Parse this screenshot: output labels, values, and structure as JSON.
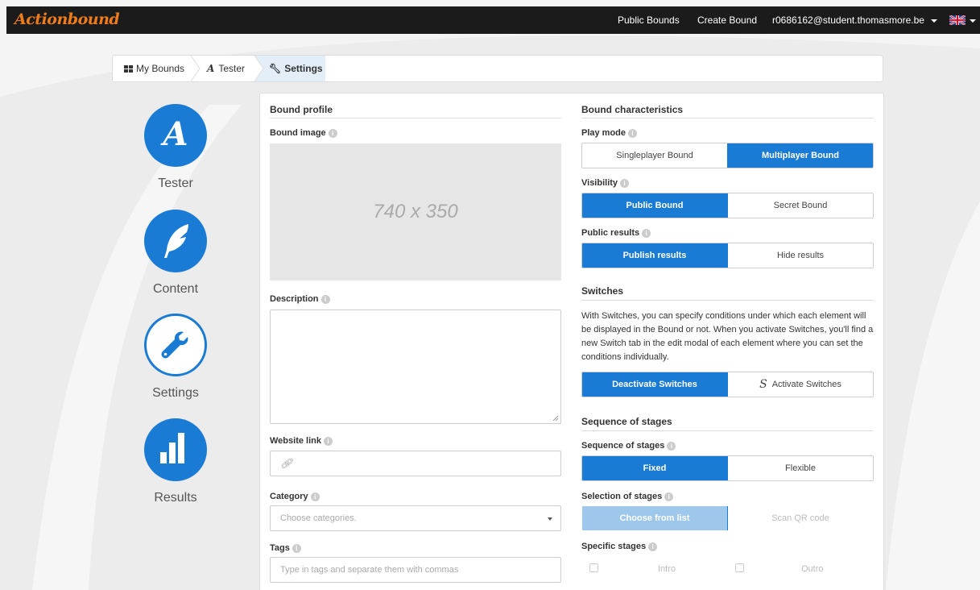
{
  "app": {
    "logo": "Actionbound",
    "nav": {
      "public_bounds": "Public Bounds",
      "create_bound": "Create Bound",
      "user": "r0686162@student.thomasmore.be"
    },
    "language_icon": "uk-flag-icon"
  },
  "breadcrumb": {
    "items": [
      "My Bounds",
      "Tester",
      "Settings"
    ]
  },
  "sidebar": {
    "items": [
      {
        "label": "Tester",
        "icon": "actionbound-a-icon"
      },
      {
        "label": "Content",
        "icon": "feather-icon"
      },
      {
        "label": "Settings",
        "icon": "wrench-icon"
      },
      {
        "label": "Results",
        "icon": "bar-chart-icon"
      }
    ]
  },
  "profile": {
    "title": "Bound profile",
    "image_label": "Bound image",
    "image_placeholder": "740 x 350",
    "description_label": "Description",
    "website_label": "Website link",
    "category_label": "Category",
    "category_placeholder": "Choose categories.",
    "tags_label": "Tags",
    "tags_placeholder": "Type in tags and separate them with commas"
  },
  "characteristics": {
    "title": "Bound characteristics",
    "play_mode_label": "Play mode",
    "play_mode_options": [
      "Singleplayer Bound",
      "Multiplayer Bound"
    ],
    "play_mode_selected": "Multiplayer Bound",
    "visibility_label": "Visibility",
    "visibility_options": [
      "Public Bound",
      "Secret Bound"
    ],
    "visibility_selected": "Public Bound",
    "results_label": "Public results",
    "results_options": [
      "Publish results",
      "Hide results"
    ],
    "results_selected": "Publish results"
  },
  "switches": {
    "title": "Switches",
    "description": "With Switches, you can specify conditions under which each element will be displayed in the Bound or not. When you activate Switches, you'll find a new Switch tab in the edit modal of each element where you can set the conditions individually.",
    "options": [
      "Deactivate Switches",
      "Activate Switches"
    ],
    "selected": "Deactivate Switches"
  },
  "stages": {
    "title": "Sequence of stages",
    "sequence_label": "Sequence of stages",
    "sequence_options": [
      "Fixed",
      "Flexible"
    ],
    "sequence_selected": "Fixed",
    "selection_label": "Selection of stages",
    "selection_options": [
      "Choose from list",
      "Scan QR code"
    ],
    "selection_selected": "Choose from list",
    "specific_label": "Specific stages",
    "specific_options": [
      "Intro",
      "Outro"
    ]
  },
  "colors": {
    "accent": "#1a7bd4",
    "logo": "#f07d1a",
    "topbar": "#1b1b1b"
  }
}
